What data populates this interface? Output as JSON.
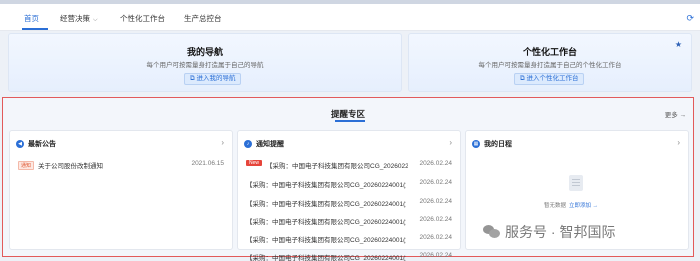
{
  "menu": {
    "items": [
      {
        "label": "首页"
      },
      {
        "label": "经营决策"
      },
      {
        "label": "个性化工作台"
      },
      {
        "label": "生产总控台"
      }
    ]
  },
  "cards": {
    "nav": {
      "title": "我的导航",
      "subtitle": "每个用户可按需量身打造属于自己的导航",
      "button": "进入我的导航"
    },
    "workbench": {
      "title": "个性化工作台",
      "subtitle": "每个用户可按需量身打造属于自己的个性化工作台",
      "button": "进入个性化工作台"
    }
  },
  "tixing": {
    "title": "提醒专区",
    "more": "更多 →"
  },
  "announcements": {
    "title": "最新公告",
    "items": [
      {
        "tag": "通知",
        "text": "关于公司股份改制通知",
        "date": "2021.06.15"
      }
    ]
  },
  "notices": {
    "title": "通知提醒",
    "items": [
      {
        "tag": "New",
        "text": "【采购：中国电子科技集团有限公司CG_20260224...",
        "date": "2026.02.24"
      },
      {
        "text": "【采购：中国电子科技集团有限公司CG_20260224001(复...",
        "date": "2026.02.24"
      },
      {
        "text": "【采购：中国电子科技集团有限公司CG_20260224001(复...",
        "date": "2026.02.24"
      },
      {
        "text": "【采购：中国电子科技集团有限公司CG_20260224001(复...",
        "date": "2026.02.24"
      },
      {
        "text": "【采购：中国电子科技集团有限公司CG_20260224001(复...",
        "date": "2026.02.24"
      },
      {
        "text": "【采购：中国电子科技集团有限公司CG_20260224001(复...",
        "date": "2026.02.24"
      }
    ]
  },
  "schedule": {
    "title": "我的日程",
    "empty_text": "暂无数据",
    "empty_link": "立即添加 →"
  },
  "watermark": "服务号 · 智邦国际"
}
